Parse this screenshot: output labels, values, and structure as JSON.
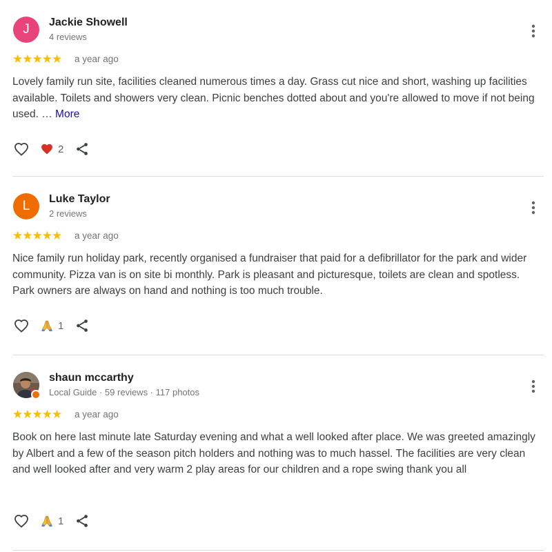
{
  "colors": {
    "star": "#fbbc04",
    "link": "#1a0dab",
    "avatar_j": "#e8437a",
    "avatar_l": "#ef6c00",
    "heart": "#d93025"
  },
  "reviews": [
    {
      "initial": "J",
      "name": "Jackie Showell",
      "meta": "4 reviews",
      "stars": "★★★★★",
      "rating": 5,
      "when": "a year ago",
      "text": "Lovely family run site, facilities cleaned numerous times a day. Grass cut nice and short, washing up facilities available. Toilets and showers very clean. Picnic benches dotted about and you're allowed to move if not being used. …",
      "more": "More",
      "reaction_icon": "red-heart-emoji",
      "reaction_count": "2"
    },
    {
      "initial": "L",
      "name": "Luke Taylor",
      "meta": "2 reviews",
      "stars": "★★★★★",
      "rating": 5,
      "when": "a year ago",
      "text": "Nice family run holiday park, recently organised a fundraiser that paid for a defibrillator for the park and wider community. Pizza van is on site bi monthly. Park is pleasant and picturesque, toilets are clean and spotless. Park owners are always on hand and nothing is too much trouble.",
      "reaction_icon": "folded-hands-emoji",
      "reaction_count": "1"
    },
    {
      "name": "shaun mccarthy",
      "meta": "Local Guide · 59 reviews · 117 photos",
      "stars": "★★★★★",
      "rating": 5,
      "when": "a year ago",
      "text": "Book on here last minute late Saturday evening and what a well looked after place. We was greeted amazingly by Albert and a few of the season pitch holders and nothing was to much hassel. The facilities are very clean and well looked after and very warm 2 play areas for our children and a rope swing thank you all",
      "reaction_icon": "folded-hands-emoji",
      "reaction_count": "1"
    }
  ]
}
